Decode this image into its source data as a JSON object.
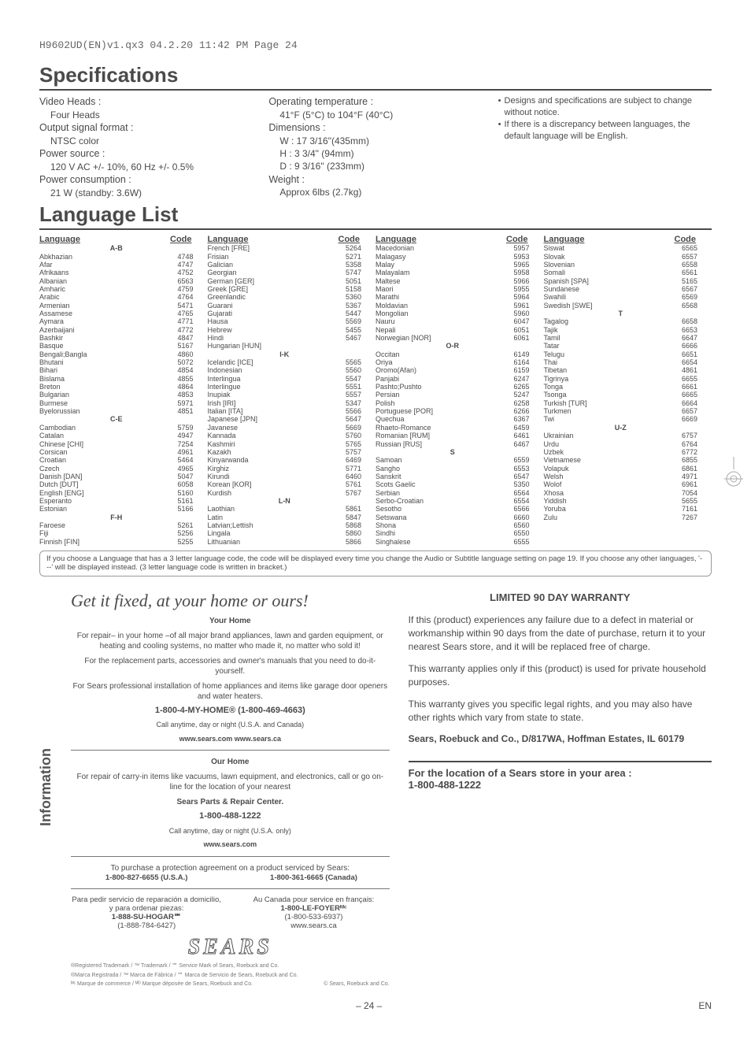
{
  "page_header": "H9602UD(EN)v1.qx3  04.2.20  11:42 PM  Page 24",
  "sections": {
    "specs_title": "Specifications",
    "lang_title": "Language List"
  },
  "specs": {
    "col1": [
      {
        "head": "Video Heads :",
        "sub": "Four Heads"
      },
      {
        "head": "Output signal format :",
        "sub": "NTSC color"
      },
      {
        "head": "Power source :",
        "sub": "120 V AC +/- 10%, 60 Hz +/- 0.5%"
      },
      {
        "head": "Power consumption :",
        "sub": "21 W (standby: 3.6W)"
      }
    ],
    "col2": [
      {
        "head": "Operating temperature :",
        "sub": "41°F (5°C) to 104°F (40°C)"
      },
      {
        "head": "Dimensions :",
        "sub": "W : 17 3/16\"(435mm)\nH  : 3 3/4\"    (94mm)\nD  : 9 3/16\"  (233mm)"
      },
      {
        "head": "Weight :",
        "sub": "Approx  6lbs (2.7kg)"
      }
    ],
    "col3": [
      "Designs and specifications are subject to change without notice.",
      "If there is a discrepancy between languages, the default language will be English."
    ]
  },
  "lang_header": {
    "l": "Language",
    "c": "Code"
  },
  "lang_cols": [
    [
      {
        "letter": "A-B"
      },
      {
        "name": "Abkhazian",
        "code": "4748"
      },
      {
        "name": "Afar",
        "code": "4747"
      },
      {
        "name": "Afrikaans",
        "code": "4752"
      },
      {
        "name": "Albanian",
        "code": "6563"
      },
      {
        "name": "Amharic",
        "code": "4759"
      },
      {
        "name": "Arabic",
        "code": "4764"
      },
      {
        "name": "Armenian",
        "code": "5471"
      },
      {
        "name": "Assamese",
        "code": "4765"
      },
      {
        "name": "Aymara",
        "code": "4771"
      },
      {
        "name": "Azerbaijani",
        "code": "4772"
      },
      {
        "name": "Bashkir",
        "code": "4847"
      },
      {
        "name": "Basque",
        "code": "5167"
      },
      {
        "name": "Bengali;Bangla",
        "code": "4860"
      },
      {
        "name": "Bhutani",
        "code": "5072"
      },
      {
        "name": "Bihari",
        "code": "4854"
      },
      {
        "name": "Bislama",
        "code": "4855"
      },
      {
        "name": "Breton",
        "code": "4864"
      },
      {
        "name": "Bulgarian",
        "code": "4853"
      },
      {
        "name": "Burmese",
        "code": "5971"
      },
      {
        "name": "Byelorussian",
        "code": "4851"
      },
      {
        "letter": "C-E"
      },
      {
        "name": "Cambodian",
        "code": "5759"
      },
      {
        "name": "Catalan",
        "code": "4947"
      },
      {
        "name": "Chinese [CHI]",
        "code": "7254"
      },
      {
        "name": "Corsican",
        "code": "4961"
      },
      {
        "name": "Croatian",
        "code": "5464"
      },
      {
        "name": "Czech",
        "code": "4965"
      },
      {
        "name": "Danish [DAN]",
        "code": "5047"
      },
      {
        "name": "Dutch [DUT]",
        "code": "6058"
      },
      {
        "name": "English [ENG]",
        "code": "5160"
      },
      {
        "name": "Esperanto",
        "code": "5161"
      },
      {
        "name": "Estonian",
        "code": "5166"
      },
      {
        "letter": "F-H"
      },
      {
        "name": "Faroese",
        "code": "5261"
      },
      {
        "name": "Fiji",
        "code": "5256"
      },
      {
        "name": "Finnish [FIN]",
        "code": "5255"
      }
    ],
    [
      {
        "name": "French [FRE]",
        "code": "5264"
      },
      {
        "name": "Frisian",
        "code": "5271"
      },
      {
        "name": "Galician",
        "code": "5358"
      },
      {
        "name": "Georgian",
        "code": "5747"
      },
      {
        "name": "German [GER]",
        "code": "5051"
      },
      {
        "name": "Greek [GRE]",
        "code": "5158"
      },
      {
        "name": "Greenlandic",
        "code": "5360"
      },
      {
        "name": "Guarani",
        "code": "5367"
      },
      {
        "name": "Gujarati",
        "code": "5447"
      },
      {
        "name": "Hausa",
        "code": "5569"
      },
      {
        "name": "Hebrew",
        "code": "5455"
      },
      {
        "name": "Hindi",
        "code": "5467"
      },
      {
        "name": "Hungarian [HUN]",
        "code": ""
      },
      {
        "letter": "I-K"
      },
      {
        "name": "Icelandic [ICE]",
        "code": "5565"
      },
      {
        "name": "Indonesian",
        "code": "5560"
      },
      {
        "name": "Interlingua",
        "code": "5547"
      },
      {
        "name": "Interlingue",
        "code": "5551"
      },
      {
        "name": "Inupiak",
        "code": "5557"
      },
      {
        "name": "Irish [IRI]",
        "code": "5347"
      },
      {
        "name": "Italian [ITA]",
        "code": "5566"
      },
      {
        "name": "Japanese [JPN]",
        "code": "5647"
      },
      {
        "name": "Javanese",
        "code": "5669"
      },
      {
        "name": "Kannada",
        "code": "5760"
      },
      {
        "name": "Kashmiri",
        "code": "5765"
      },
      {
        "name": "Kazakh",
        "code": "5757"
      },
      {
        "name": "Kinyarwanda",
        "code": "6469"
      },
      {
        "name": "Kirghiz",
        "code": "5771"
      },
      {
        "name": "Kirundi",
        "code": "6460"
      },
      {
        "name": "Korean [KOR]",
        "code": "5761"
      },
      {
        "name": "Kurdish",
        "code": "5767"
      },
      {
        "letter": "L-N"
      },
      {
        "name": "Laothian",
        "code": "5861"
      },
      {
        "name": "Latin",
        "code": "5847"
      },
      {
        "name": "Latvian;Lettish",
        "code": "5868"
      },
      {
        "name": "Lingala",
        "code": "5860"
      },
      {
        "name": "Lithuanian",
        "code": "5866"
      }
    ],
    [
      {
        "name": "Macedonian",
        "code": "5957"
      },
      {
        "name": "Malagasy",
        "code": "5953"
      },
      {
        "name": "Malay",
        "code": "5965"
      },
      {
        "name": "Malayalam",
        "code": "5958"
      },
      {
        "name": "Maltese",
        "code": "5966"
      },
      {
        "name": "Maori",
        "code": "5955"
      },
      {
        "name": "Marathi",
        "code": "5964"
      },
      {
        "name": "Moldavian",
        "code": "5961"
      },
      {
        "name": "Mongolian",
        "code": "5960"
      },
      {
        "name": "Nauru",
        "code": "6047"
      },
      {
        "name": "Nepali",
        "code": "6051"
      },
      {
        "name": "Norwegian [NOR]",
        "code": "6061"
      },
      {
        "letter": "O-R"
      },
      {
        "name": "Occitan",
        "code": "6149"
      },
      {
        "name": "Oriya",
        "code": "6164"
      },
      {
        "name": "Oromo(Afan)",
        "code": "6159"
      },
      {
        "name": "Panjabi",
        "code": "6247"
      },
      {
        "name": "Pashto;Pushto",
        "code": "6265"
      },
      {
        "name": "Persian",
        "code": "5247"
      },
      {
        "name": "Polish",
        "code": "6258"
      },
      {
        "name": "Portuguese [POR]",
        "code": "6266"
      },
      {
        "name": "Quechua",
        "code": "6367"
      },
      {
        "name": "Rhaeto-Romance",
        "code": "6459"
      },
      {
        "name": "Romanian [RUM]",
        "code": "6461"
      },
      {
        "name": "Russian [RUS]",
        "code": "6467"
      },
      {
        "letter": "S"
      },
      {
        "name": "Samoan",
        "code": "6559"
      },
      {
        "name": "Sangho",
        "code": "6553"
      },
      {
        "name": "Sanskrit",
        "code": "6547"
      },
      {
        "name": "Scots Gaelic",
        "code": "5350"
      },
      {
        "name": "Serbian",
        "code": "6564"
      },
      {
        "name": "Serbo-Croatian",
        "code": "6554"
      },
      {
        "name": "Sesotho",
        "code": "6566"
      },
      {
        "name": "Setswana",
        "code": "6660"
      },
      {
        "name": "Shona",
        "code": "6560"
      },
      {
        "name": "Sindhi",
        "code": "6550"
      },
      {
        "name": "Singhalese",
        "code": "6555"
      }
    ],
    [
      {
        "name": "Siswat",
        "code": "6565"
      },
      {
        "name": "Slovak",
        "code": "6557"
      },
      {
        "name": "Slovenian",
        "code": "6558"
      },
      {
        "name": "Somali",
        "code": "6561"
      },
      {
        "name": "Spanish [SPA]",
        "code": "5165"
      },
      {
        "name": "Sundanese",
        "code": "6567"
      },
      {
        "name": "Swahili",
        "code": "6569"
      },
      {
        "name": "Swedish [SWE]",
        "code": "6568"
      },
      {
        "letter": "T"
      },
      {
        "name": "Tagalog",
        "code": "6658"
      },
      {
        "name": "Tajik",
        "code": "6653"
      },
      {
        "name": "Tamil",
        "code": "6647"
      },
      {
        "name": "Tatar",
        "code": "6666"
      },
      {
        "name": "Telugu",
        "code": "6651"
      },
      {
        "name": "Thai",
        "code": "6654"
      },
      {
        "name": "Tibetan",
        "code": "4861"
      },
      {
        "name": "Tigrinya",
        "code": "6655"
      },
      {
        "name": "Tonga",
        "code": "6661"
      },
      {
        "name": "Tsonga",
        "code": "6665"
      },
      {
        "name": "Turkish [TUR]",
        "code": "6664"
      },
      {
        "name": "Turkmen",
        "code": "6657"
      },
      {
        "name": "Twi",
        "code": "6669"
      },
      {
        "letter": "U-Z"
      },
      {
        "name": "Ukrainian",
        "code": "6757"
      },
      {
        "name": "Urdu",
        "code": "6764"
      },
      {
        "name": "Uzbek",
        "code": "6772"
      },
      {
        "name": "Vietnamese",
        "code": "6855"
      },
      {
        "name": "Volapuk",
        "code": "6861"
      },
      {
        "name": "Welsh",
        "code": "4971"
      },
      {
        "name": "Wolof",
        "code": "6961"
      },
      {
        "name": "Xhosa",
        "code": "7054"
      },
      {
        "name": "Yiddish",
        "code": "5655"
      },
      {
        "name": "Yoruba",
        "code": "7161"
      },
      {
        "name": "Zulu",
        "code": "7267"
      }
    ]
  ],
  "lang_note": "If you choose a Language that has a 3 letter language code, the code will be displayed every time you change the Audio or Subtitle language setting on page 19. If you choose any other languages, '---' will be displayed instead. (3 letter language code is written in bracket.)",
  "info_tab": "Information",
  "fix": {
    "title": "Get it fixed, at your home or ours!",
    "your_home": "Your Home",
    "yh1": "For repair– in your home –of all major brand appliances, lawn and garden equipment, or heating and cooling systems, no matter who made it, no matter who sold it!",
    "yh2": "For the replacement parts, accessories and owner's manuals that you need to do-it-yourself.",
    "yh3": "For Sears professional installation of home appliances and items like garage door openers and water heaters.",
    "yh_phone": "1-800-4-MY-HOME®   (1-800-469-4663)",
    "yh_call": "Call anytime, day or night (U.S.A. and Canada)",
    "yh_www": "www.sears.com      www.sears.ca",
    "our_home": "Our Home",
    "oh1": "For repair of carry-in items like vacuums, lawn equipment, and electronics, call or go on-line for the location of your nearest",
    "oh2": "Sears Parts & Repair Center.",
    "oh_phone": "1-800-488-1222",
    "oh_call": "Call anytime, day or night (U.S.A. only)",
    "oh_www": "www.sears.com",
    "purchase": "To purchase a protection agreement on a product serviced by Sears:",
    "p_us": "1-800-827-6655 (U.S.A.)",
    "p_ca": "1-800-361-6665 (Canada)",
    "sp_title": "Para pedir servicio de reparación a domicilio, y para ordenar piezas:",
    "sp_phone": "1-888-SU-HOGAR℠",
    "sp_num": "(1-888-784-6427)",
    "fr_title": "Au Canada pour service en français:",
    "fr_phone": "1-800-LE-FOYERᴹᶜ",
    "fr_num": "(1-800-533-6937)",
    "fr_www": "www.sears.ca",
    "logo": "SEARS",
    "legal1": "®Registered Trademark / ™ Trademark / ℠ Service Mark of Sears, Roebuck and Co.",
    "legal2": "®Marca Registrada / ™ Marca de Fábrica / ℠ Marca de Servicio de Sears, Roebuck and Co.",
    "legal3": "ᴹᶜ Marque de commerce / ᴹᴰ Marque déposée de Sears, Roebuck and Co.",
    "legal4": "© Sears, Roebuck and Co."
  },
  "warranty": {
    "title": "LIMITED 90 DAY WARRANTY",
    "p1": "If this (product) experiences any failure due to a defect in material or workmanship within 90 days from the date of purchase, return it to your nearest Sears store, and it will be replaced free of charge.",
    "p2": "This warranty applies only if this (product) is used for private household purposes.",
    "p3": "This warranty gives you specific legal rights, and you may also have other rights which vary from state to state.",
    "p4": "Sears, Roebuck and Co., D/817WA, Hoffman Estates, IL 60179"
  },
  "store": {
    "line1": "For the location of a Sears store in your area :",
    "line2": "1-800-488-1222"
  },
  "footer": {
    "page": "– 24 –",
    "lang": "EN"
  }
}
